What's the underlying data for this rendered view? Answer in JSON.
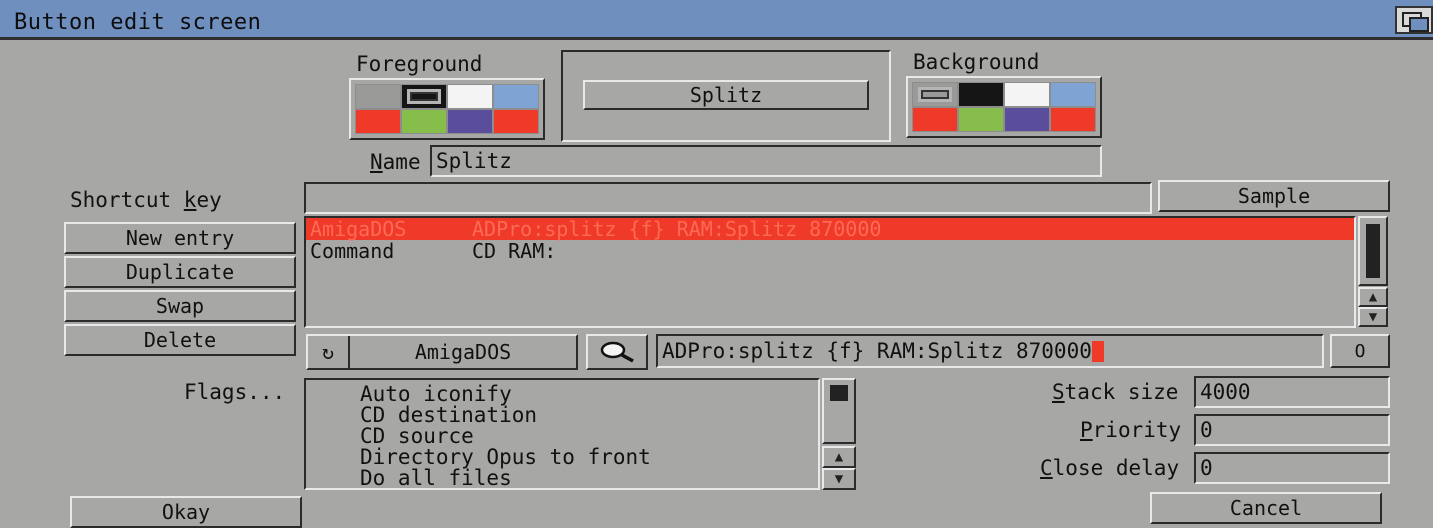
{
  "window": {
    "title": "Button edit screen"
  },
  "colors": {
    "foreground_palette": [
      "#9a9a98",
      "#151515",
      "#f4f4f4",
      "#7fa3d2",
      "#ef3a2a",
      "#86bd4b",
      "#5a4d9c",
      "#ef3a2a"
    ],
    "background_palette": [
      "#9a9a98",
      "#151515",
      "#f4f4f4",
      "#7fa3d2",
      "#ef3a2a",
      "#86bd4b",
      "#5a4d9c",
      "#ef3a2a"
    ],
    "highlight": "#ef3a2a",
    "titlebar": "#6f8fbf"
  },
  "foreground": {
    "label": "Foreground"
  },
  "background": {
    "label": "Background"
  },
  "preview": {
    "button_label": "Splitz"
  },
  "name": {
    "label_underlined": "N",
    "label_rest": "ame",
    "value": "Splitz"
  },
  "shortcut": {
    "label_pre": "Shortcut ",
    "label_underlined": "k",
    "label_rest": "ey",
    "value": ""
  },
  "sample_button": "Sample",
  "left_buttons": {
    "new_entry": "New entry",
    "duplicate": "Duplicate",
    "swap": "Swap",
    "delete": "Delete"
  },
  "commands": {
    "rows": [
      {
        "type": "AmigaDOS",
        "text": "ADPro:splitz {f} RAM:Splitz 870000",
        "selected": true
      },
      {
        "type": "Command",
        "text": "CD RAM:",
        "selected": false
      }
    ]
  },
  "function_type": {
    "label": "AmigaDOS",
    "cycle_icon": "cycle-icon"
  },
  "lookup": {
    "icon": "magnifier-icon"
  },
  "command_input": {
    "value": "ADPro:splitz {f} RAM:Splitz 870000"
  },
  "arg_button": {
    "label": "O"
  },
  "flags": {
    "label": "Flags...",
    "items": [
      "Auto iconify",
      "CD destination",
      "CD source",
      "Directory Opus to front",
      "Do all files"
    ]
  },
  "stack_size": {
    "label_underlined": "S",
    "label_rest": "tack size",
    "value": "4000"
  },
  "priority": {
    "label_underlined": "P",
    "label_rest": "riority",
    "value": "0"
  },
  "close_delay": {
    "label_underlined": "C",
    "label_rest": "lose delay",
    "value": "0"
  },
  "okay_button": "Okay",
  "cancel_button": "Cancel"
}
